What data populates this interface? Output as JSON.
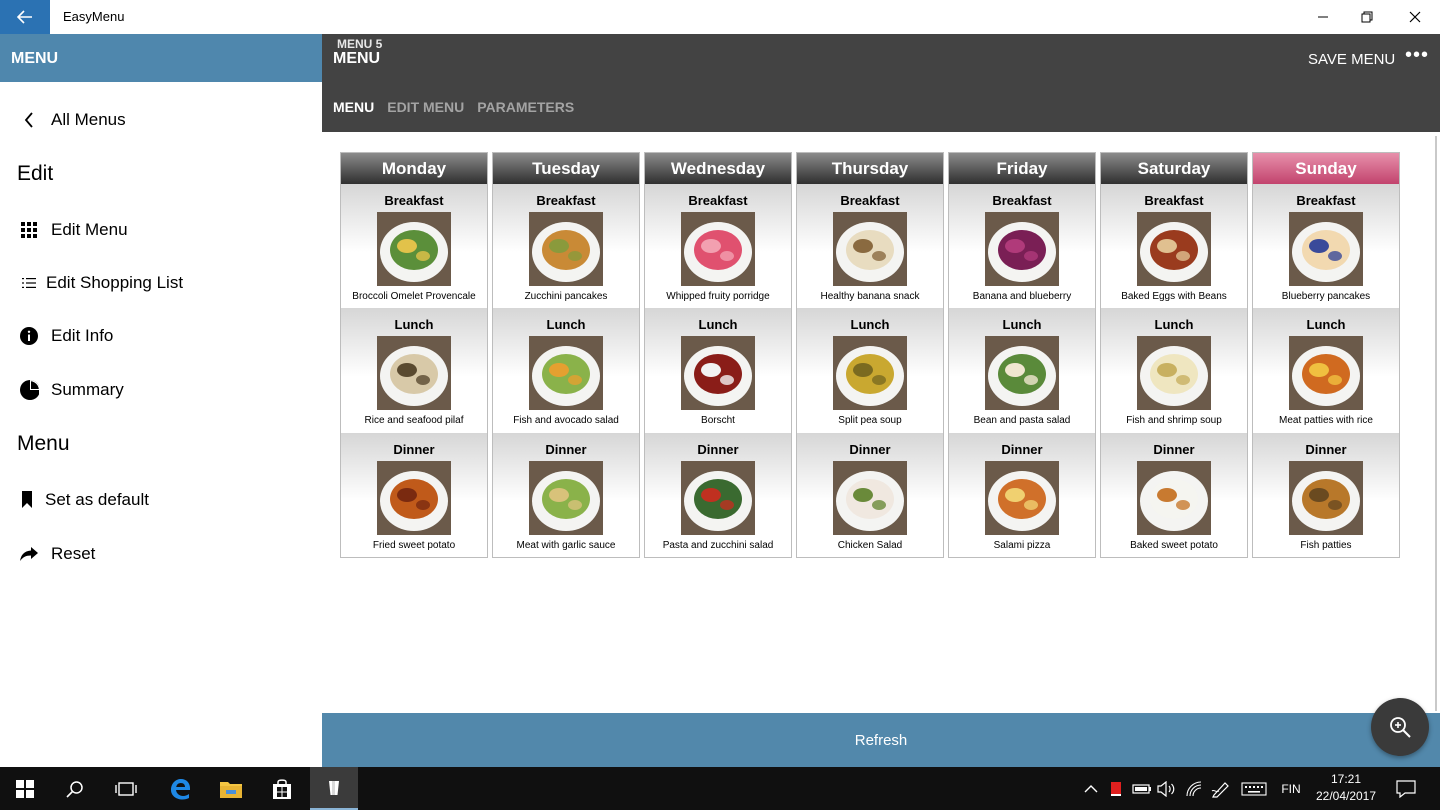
{
  "window": {
    "title": "EasyMenu"
  },
  "sidebar": {
    "header": "MENU",
    "back_label": "All Menus",
    "section_edit": "Edit",
    "edit_items": [
      {
        "label": "Edit Menu",
        "icon": "grid-icon"
      },
      {
        "label": "Edit Shopping List",
        "icon": "list-icon"
      },
      {
        "label": "Edit Info",
        "icon": "info-icon"
      },
      {
        "label": "Summary",
        "icon": "pie-chart-icon"
      }
    ],
    "section_menu": "Menu",
    "menu_items": [
      {
        "label": "Set as default",
        "icon": "bookmark-icon"
      },
      {
        "label": "Reset",
        "icon": "share-arrow-icon"
      }
    ]
  },
  "header": {
    "subtitle": "MENU 5",
    "title": "MENU",
    "save_label": "SAVE MENU",
    "more": "•••",
    "tabs": [
      "MENU",
      "EDIT MENU",
      "PARAMETERS"
    ]
  },
  "week": [
    {
      "day": "Monday",
      "meals": [
        {
          "type": "Breakfast",
          "name": "Broccoli Omelet Provencale"
        },
        {
          "type": "Lunch",
          "name": "Rice and seafood pilaf"
        },
        {
          "type": "Dinner",
          "name": "Fried sweet potato"
        }
      ]
    },
    {
      "day": "Tuesday",
      "meals": [
        {
          "type": "Breakfast",
          "name": "Zucchini pancakes"
        },
        {
          "type": "Lunch",
          "name": "Fish and avocado salad"
        },
        {
          "type": "Dinner",
          "name": "Meat with garlic sauce"
        }
      ]
    },
    {
      "day": "Wednesday",
      "meals": [
        {
          "type": "Breakfast",
          "name": "Whipped fruity porridge"
        },
        {
          "type": "Lunch",
          "name": "Borscht"
        },
        {
          "type": "Dinner",
          "name": "Pasta and zucchini salad"
        }
      ]
    },
    {
      "day": "Thursday",
      "meals": [
        {
          "type": "Breakfast",
          "name": "Healthy banana snack"
        },
        {
          "type": "Lunch",
          "name": "Split pea soup"
        },
        {
          "type": "Dinner",
          "name": "Chicken Salad"
        }
      ]
    },
    {
      "day": "Friday",
      "meals": [
        {
          "type": "Breakfast",
          "name": "Banana and blueberry"
        },
        {
          "type": "Lunch",
          "name": "Bean and pasta salad"
        },
        {
          "type": "Dinner",
          "name": "Salami pizza"
        }
      ]
    },
    {
      "day": "Saturday",
      "meals": [
        {
          "type": "Breakfast",
          "name": "Baked Eggs with Beans"
        },
        {
          "type": "Lunch",
          "name": "Fish and shrimp soup"
        },
        {
          "type": "Dinner",
          "name": "Baked sweet potato"
        }
      ]
    },
    {
      "day": "Sunday",
      "meals": [
        {
          "type": "Breakfast",
          "name": "Blueberry pancakes"
        },
        {
          "type": "Lunch",
          "name": "Meat patties with rice"
        },
        {
          "type": "Dinner",
          "name": "Fish patties"
        }
      ]
    }
  ],
  "refresh_label": "Refresh",
  "taskbar": {
    "language": "FIN",
    "time": "17:21",
    "date": "22/04/2017"
  },
  "colors": {
    "accent": "#4f87ad",
    "header_bg": "#434343",
    "highlight_day": "#c2436d",
    "taskbar_bg": "#101010"
  }
}
